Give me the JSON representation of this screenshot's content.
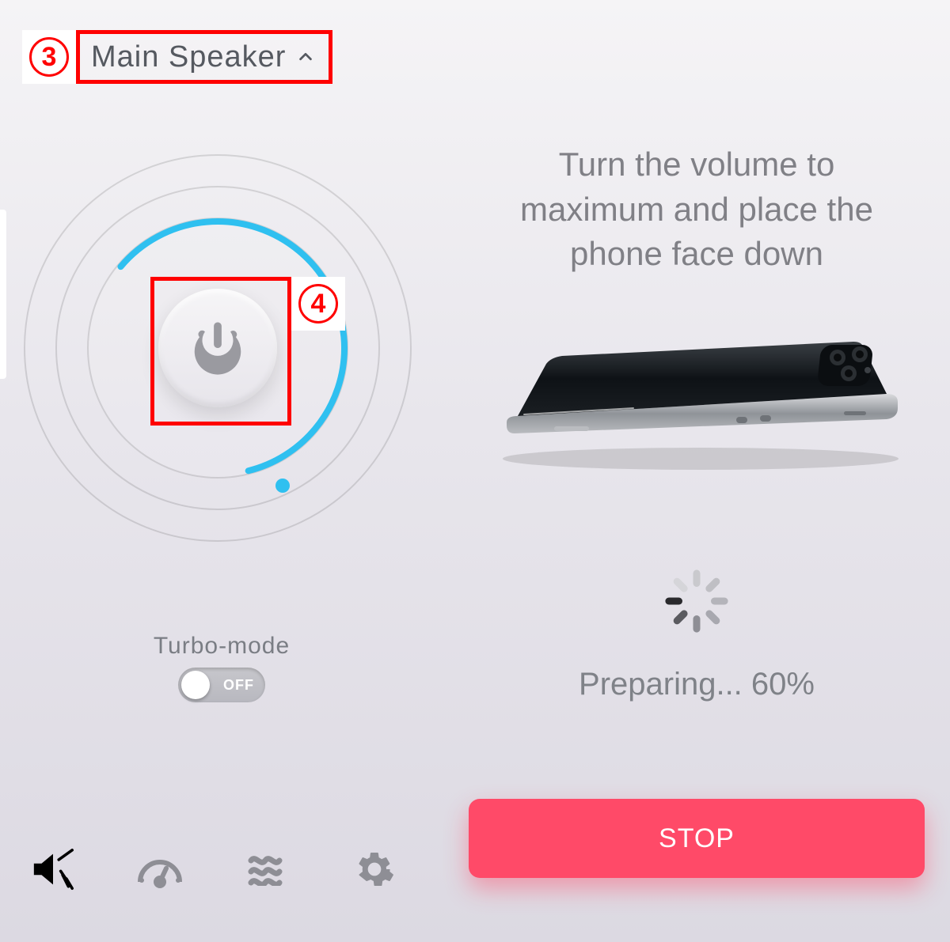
{
  "annotations": {
    "marker3": "3",
    "marker4": "4"
  },
  "dropdown": {
    "label": "Main Speaker"
  },
  "turbo": {
    "label": "Turbo-mode",
    "state_text": "OFF",
    "on": false
  },
  "instruction": "Turn the volume to maximum and place the phone face down",
  "status": {
    "text": "Preparing... 60%",
    "percent": 60
  },
  "stop_button": "STOP",
  "colors": {
    "accent_marker": "#ff0000",
    "progress": "#2fc0f0",
    "stop": "#ff4a68"
  },
  "nav": {
    "items": [
      "speaker-clean",
      "stereo-test",
      "vibration",
      "settings"
    ],
    "active_index": 0
  }
}
